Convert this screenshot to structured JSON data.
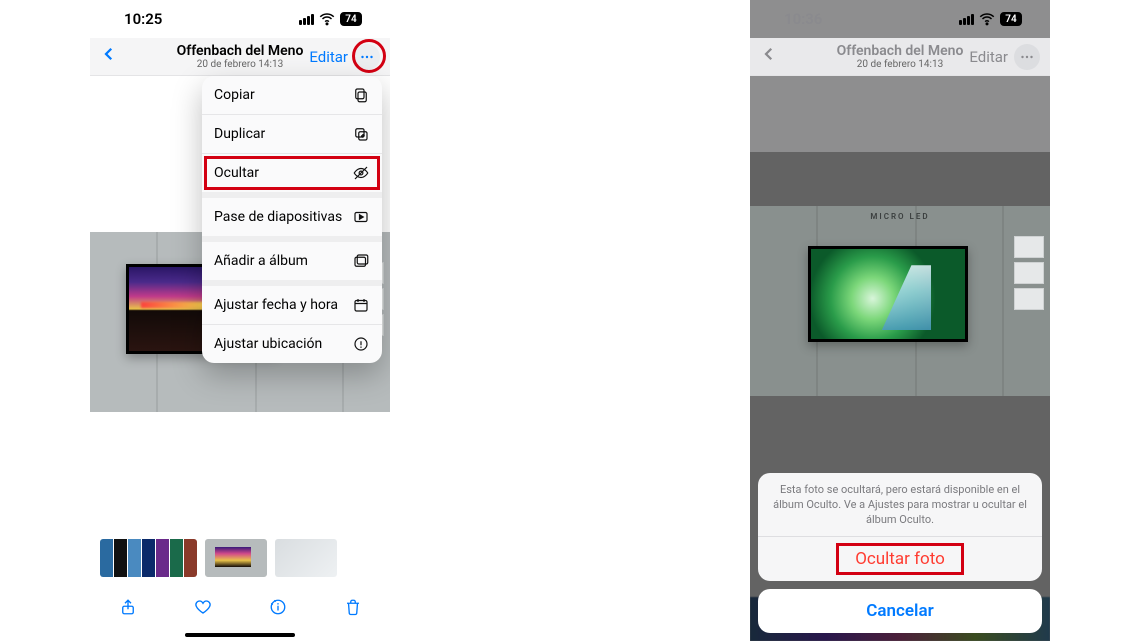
{
  "left": {
    "status": {
      "time": "10:25",
      "battery": "74"
    },
    "nav": {
      "title": "Offenbach del Meno",
      "subtitle": "20 de febrero  14:13",
      "edit": "Editar"
    },
    "menu": {
      "items": [
        {
          "label": "Copiar",
          "icon": "copy-icon"
        },
        {
          "label": "Duplicar",
          "icon": "duplicate-icon"
        },
        {
          "label": "Ocultar",
          "icon": "hide-icon",
          "highlight": true,
          "group_end": true
        },
        {
          "label": "Pase de diapositivas",
          "icon": "slideshow-icon",
          "group_end": true
        },
        {
          "label": "Añadir a álbum",
          "icon": "add-album-icon",
          "group_end": true
        },
        {
          "label": "Ajustar fecha y hora",
          "icon": "adjust-date-icon"
        },
        {
          "label": "Ajustar ubicación",
          "icon": "adjust-location-icon"
        }
      ]
    }
  },
  "right": {
    "status": {
      "time": "10:36",
      "battery": "74"
    },
    "nav": {
      "title": "Offenbach del Meno",
      "subtitle": "20 de febrero  14:13",
      "edit": "Editar"
    },
    "microled": "MICRO LED",
    "sheet": {
      "message": "Esta foto se ocultará, pero estará disponible en el álbum Oculto. Ve a Ajustes para mostrar u ocultar el álbum Oculto.",
      "action": "Ocultar foto",
      "cancel": "Cancelar"
    }
  }
}
